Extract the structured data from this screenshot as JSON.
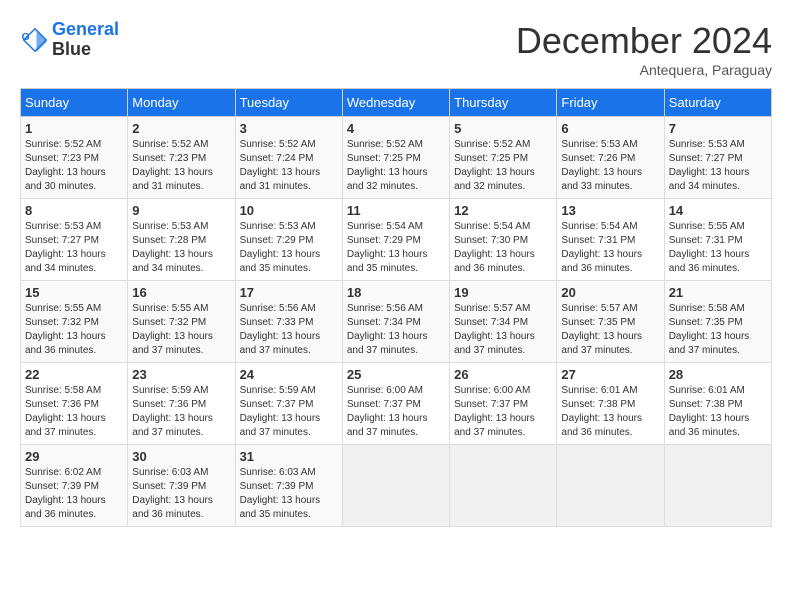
{
  "header": {
    "logo_line1": "General",
    "logo_line2": "Blue",
    "month": "December 2024",
    "location": "Antequera, Paraguay"
  },
  "weekdays": [
    "Sunday",
    "Monday",
    "Tuesday",
    "Wednesday",
    "Thursday",
    "Friday",
    "Saturday"
  ],
  "weeks": [
    [
      {
        "day": "1",
        "sunrise": "5:52 AM",
        "sunset": "7:23 PM",
        "daylight": "13 hours and 30 minutes."
      },
      {
        "day": "2",
        "sunrise": "5:52 AM",
        "sunset": "7:23 PM",
        "daylight": "13 hours and 31 minutes."
      },
      {
        "day": "3",
        "sunrise": "5:52 AM",
        "sunset": "7:24 PM",
        "daylight": "13 hours and 31 minutes."
      },
      {
        "day": "4",
        "sunrise": "5:52 AM",
        "sunset": "7:25 PM",
        "daylight": "13 hours and 32 minutes."
      },
      {
        "day": "5",
        "sunrise": "5:52 AM",
        "sunset": "7:25 PM",
        "daylight": "13 hours and 32 minutes."
      },
      {
        "day": "6",
        "sunrise": "5:53 AM",
        "sunset": "7:26 PM",
        "daylight": "13 hours and 33 minutes."
      },
      {
        "day": "7",
        "sunrise": "5:53 AM",
        "sunset": "7:27 PM",
        "daylight": "13 hours and 34 minutes."
      }
    ],
    [
      {
        "day": "8",
        "sunrise": "5:53 AM",
        "sunset": "7:27 PM",
        "daylight": "13 hours and 34 minutes."
      },
      {
        "day": "9",
        "sunrise": "5:53 AM",
        "sunset": "7:28 PM",
        "daylight": "13 hours and 34 minutes."
      },
      {
        "day": "10",
        "sunrise": "5:53 AM",
        "sunset": "7:29 PM",
        "daylight": "13 hours and 35 minutes."
      },
      {
        "day": "11",
        "sunrise": "5:54 AM",
        "sunset": "7:29 PM",
        "daylight": "13 hours and 35 minutes."
      },
      {
        "day": "12",
        "sunrise": "5:54 AM",
        "sunset": "7:30 PM",
        "daylight": "13 hours and 36 minutes."
      },
      {
        "day": "13",
        "sunrise": "5:54 AM",
        "sunset": "7:31 PM",
        "daylight": "13 hours and 36 minutes."
      },
      {
        "day": "14",
        "sunrise": "5:55 AM",
        "sunset": "7:31 PM",
        "daylight": "13 hours and 36 minutes."
      }
    ],
    [
      {
        "day": "15",
        "sunrise": "5:55 AM",
        "sunset": "7:32 PM",
        "daylight": "13 hours and 36 minutes."
      },
      {
        "day": "16",
        "sunrise": "5:55 AM",
        "sunset": "7:32 PM",
        "daylight": "13 hours and 37 minutes."
      },
      {
        "day": "17",
        "sunrise": "5:56 AM",
        "sunset": "7:33 PM",
        "daylight": "13 hours and 37 minutes."
      },
      {
        "day": "18",
        "sunrise": "5:56 AM",
        "sunset": "7:34 PM",
        "daylight": "13 hours and 37 minutes."
      },
      {
        "day": "19",
        "sunrise": "5:57 AM",
        "sunset": "7:34 PM",
        "daylight": "13 hours and 37 minutes."
      },
      {
        "day": "20",
        "sunrise": "5:57 AM",
        "sunset": "7:35 PM",
        "daylight": "13 hours and 37 minutes."
      },
      {
        "day": "21",
        "sunrise": "5:58 AM",
        "sunset": "7:35 PM",
        "daylight": "13 hours and 37 minutes."
      }
    ],
    [
      {
        "day": "22",
        "sunrise": "5:58 AM",
        "sunset": "7:36 PM",
        "daylight": "13 hours and 37 minutes."
      },
      {
        "day": "23",
        "sunrise": "5:59 AM",
        "sunset": "7:36 PM",
        "daylight": "13 hours and 37 minutes."
      },
      {
        "day": "24",
        "sunrise": "5:59 AM",
        "sunset": "7:37 PM",
        "daylight": "13 hours and 37 minutes."
      },
      {
        "day": "25",
        "sunrise": "6:00 AM",
        "sunset": "7:37 PM",
        "daylight": "13 hours and 37 minutes."
      },
      {
        "day": "26",
        "sunrise": "6:00 AM",
        "sunset": "7:37 PM",
        "daylight": "13 hours and 37 minutes."
      },
      {
        "day": "27",
        "sunrise": "6:01 AM",
        "sunset": "7:38 PM",
        "daylight": "13 hours and 36 minutes."
      },
      {
        "day": "28",
        "sunrise": "6:01 AM",
        "sunset": "7:38 PM",
        "daylight": "13 hours and 36 minutes."
      }
    ],
    [
      {
        "day": "29",
        "sunrise": "6:02 AM",
        "sunset": "7:39 PM",
        "daylight": "13 hours and 36 minutes."
      },
      {
        "day": "30",
        "sunrise": "6:03 AM",
        "sunset": "7:39 PM",
        "daylight": "13 hours and 36 minutes."
      },
      {
        "day": "31",
        "sunrise": "6:03 AM",
        "sunset": "7:39 PM",
        "daylight": "13 hours and 35 minutes."
      },
      null,
      null,
      null,
      null
    ]
  ]
}
